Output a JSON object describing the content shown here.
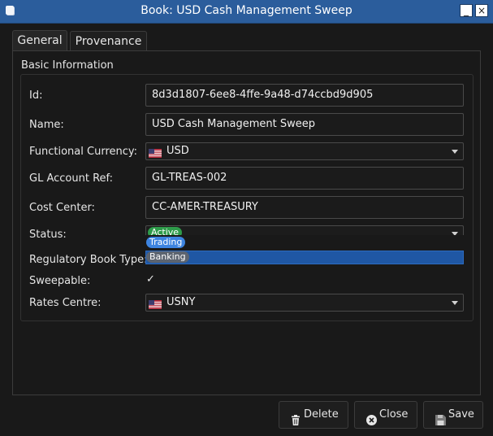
{
  "window": {
    "title": "Book: USD Cash Management Sweep",
    "minimize_label": "_",
    "close_label": "×"
  },
  "tabs": [
    {
      "label": "General",
      "active": true
    },
    {
      "label": "Provenance",
      "active": false
    }
  ],
  "group": {
    "title": "Basic Information"
  },
  "fields": {
    "id": {
      "label": "Id:",
      "value": "8d3d1807-6ee8-4ffe-9a48-d74ccbd9d905"
    },
    "name": {
      "label": "Name:",
      "value": "USD Cash Management Sweep"
    },
    "functional_currency": {
      "label": "Functional Currency:",
      "value": "USD",
      "flag": "us-flag-icon"
    },
    "gl_account_ref": {
      "label": "GL Account Ref:",
      "value": "GL-TREAS-002"
    },
    "cost_center": {
      "label": "Cost Center:",
      "value": "CC-AMER-TREASURY"
    },
    "status": {
      "label": "Status:",
      "value": "Active"
    },
    "regulatory_book_type": {
      "label": "Regulatory Book Type:",
      "options": [
        "Trading",
        "Banking"
      ],
      "highlighted": "Banking"
    },
    "sweepable": {
      "label": "Sweepable:",
      "checked": true,
      "check_glyph": "✓"
    },
    "rates_centre": {
      "label": "Rates Centre:",
      "value": "USNY",
      "flag": "us-flag-icon"
    }
  },
  "buttons": {
    "delete": "Delete",
    "close": "Close",
    "save": "Save"
  },
  "colors": {
    "titlebar": "#2b5d9c",
    "selection": "#1f57a4",
    "active_badge": "#2e9b4a",
    "trading_badge": "#3d84e0",
    "banking_badge": "#5c6470"
  }
}
